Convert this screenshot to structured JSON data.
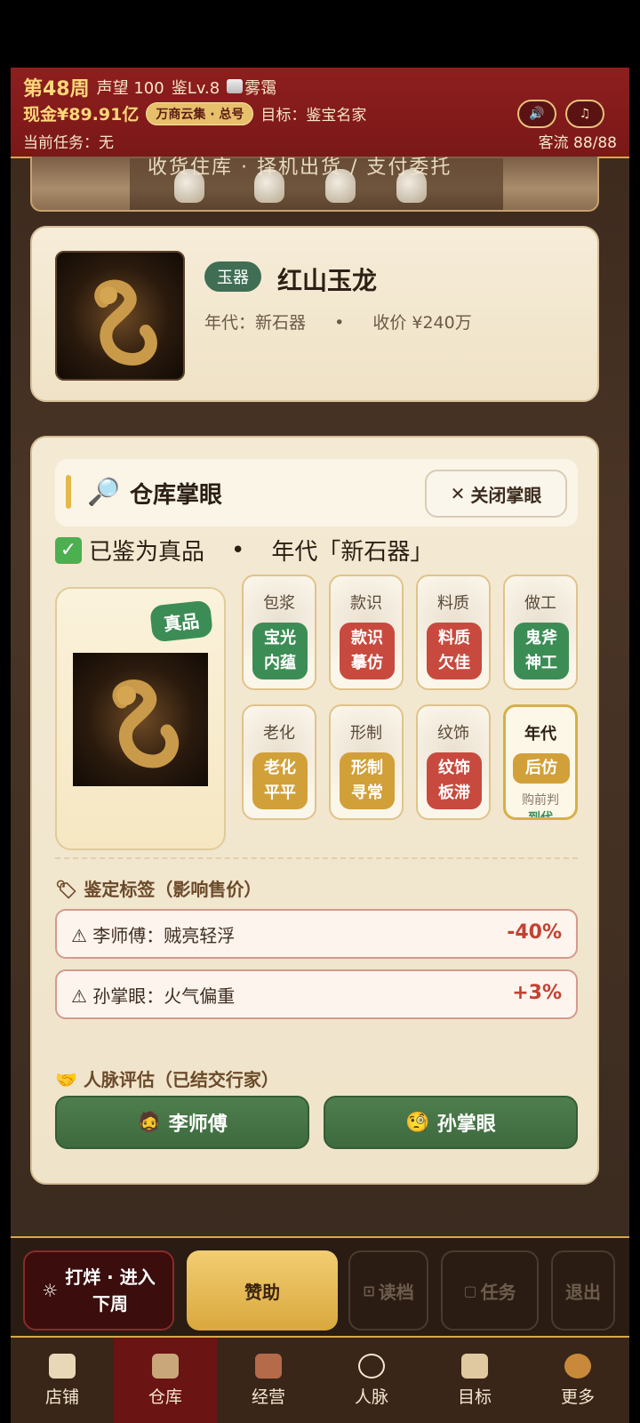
{
  "header": {
    "week": "第48周",
    "reputation": "声望 100",
    "appraise_level": "鉴Lv.8",
    "weather": "雾霭",
    "cash": "现金¥89.91亿",
    "market": "万商云集 · 总号",
    "goal": "目标：鉴宝名家",
    "task": "当前任务：无",
    "customer_flow": "客流 88/88",
    "sound_icon": "speaker-icon",
    "music_icon": "music-icon"
  },
  "banner": {
    "text": "收货住库 · 择机出货 / 支付委托"
  },
  "item": {
    "category": "玉器",
    "name": "红山玉龙",
    "era_label": "年代：新石器",
    "price_label": "收价 ¥240万"
  },
  "panel": {
    "title": "仓库掌眼",
    "close_label": "关闭掌眼",
    "verdict": "已鉴为真品",
    "verdict_era": "年代「新石器」",
    "genuine_badge": "真品",
    "attributes": [
      {
        "name": "包浆",
        "result": "宝光\n内蕴",
        "color": "green"
      },
      {
        "name": "款识",
        "result": "款识\n摹仿",
        "color": "red"
      },
      {
        "name": "料质",
        "result": "料质\n欠佳",
        "color": "red"
      },
      {
        "name": "做工",
        "result": "鬼斧\n神工",
        "color": "green"
      },
      {
        "name": "老化",
        "result": "老化\n平平",
        "color": "yellow"
      },
      {
        "name": "形制",
        "result": "形制\n寻常",
        "color": "yellow"
      },
      {
        "name": "纹饰",
        "result": "纹饰\n板滞",
        "color": "red"
      },
      {
        "name": "年代",
        "result": "后仿",
        "note": "购前判",
        "note2": "到代",
        "color": "yellow"
      }
    ],
    "tags_title": "鉴定标签（影响售价）",
    "tags": [
      {
        "label": "李师傅：贼亮轻浮",
        "value": "-40%"
      },
      {
        "label": "孙掌眼：火气偏重",
        "value": "+3%"
      }
    ],
    "network_title": "人脉评估（已结交行家）",
    "people": [
      "李师傅",
      "孙掌眼"
    ]
  },
  "actions": {
    "next": "打烊 · 进入\n下周",
    "sponsor": "赞助",
    "load": "读档",
    "task": "任务",
    "quit": "退出"
  },
  "tabs": [
    "店铺",
    "仓库",
    "经营",
    "人脉",
    "目标",
    "更多"
  ],
  "active_tab": "仓库"
}
